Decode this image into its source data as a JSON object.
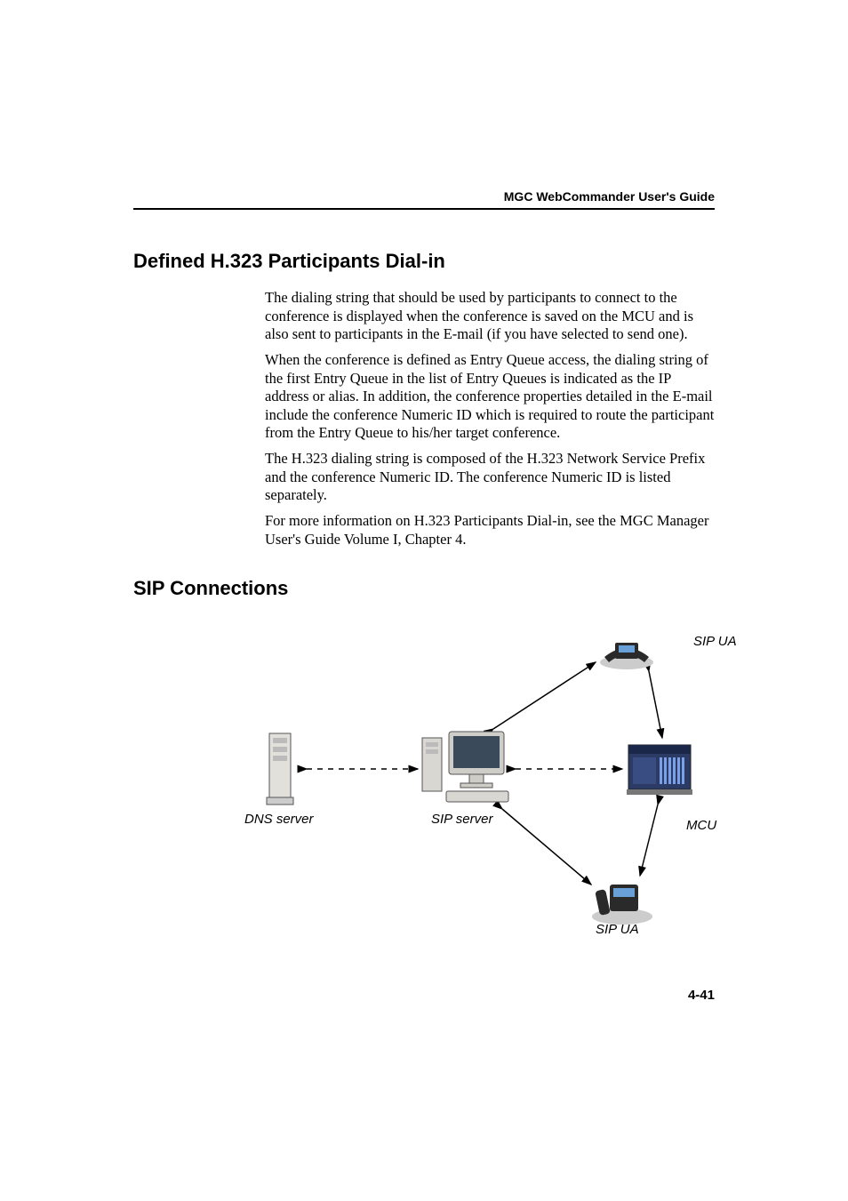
{
  "header": {
    "guide": "MGC WebCommander User's Guide"
  },
  "sections": {
    "s1": {
      "title": "Defined H.323 Participants Dial-in",
      "p1": "The dialing string that should be used by participants to connect to the conference is displayed when the conference is saved on the MCU and is also sent to participants in the E-mail (if you have selected to send one).",
      "p2": "When the conference is defined as Entry Queue access, the dialing string of the first Entry Queue in the list of Entry Queues is indicated as the IP address or alias. In addition, the conference properties detailed in the E-mail include the conference Numeric ID which is required to route the participant from the Entry Queue to his/her target conference.",
      "p3": "The H.323 dialing string is composed of the H.323 Network Service Prefix and the conference Numeric ID. The conference Numeric ID is listed separately.",
      "p4": "For more information on H.323 Participants Dial-in, see the MGC Manager User's Guide Volume I, Chapter 4."
    },
    "s2": {
      "title": "SIP Connections"
    }
  },
  "diagram": {
    "labels": {
      "sip_ua_top": "SIP UA",
      "sip_ua_bottom": "SIP UA",
      "dns_server": "DNS server",
      "sip_server": "SIP server",
      "mcu": "MCU"
    }
  },
  "footer": {
    "page": "4-41"
  }
}
